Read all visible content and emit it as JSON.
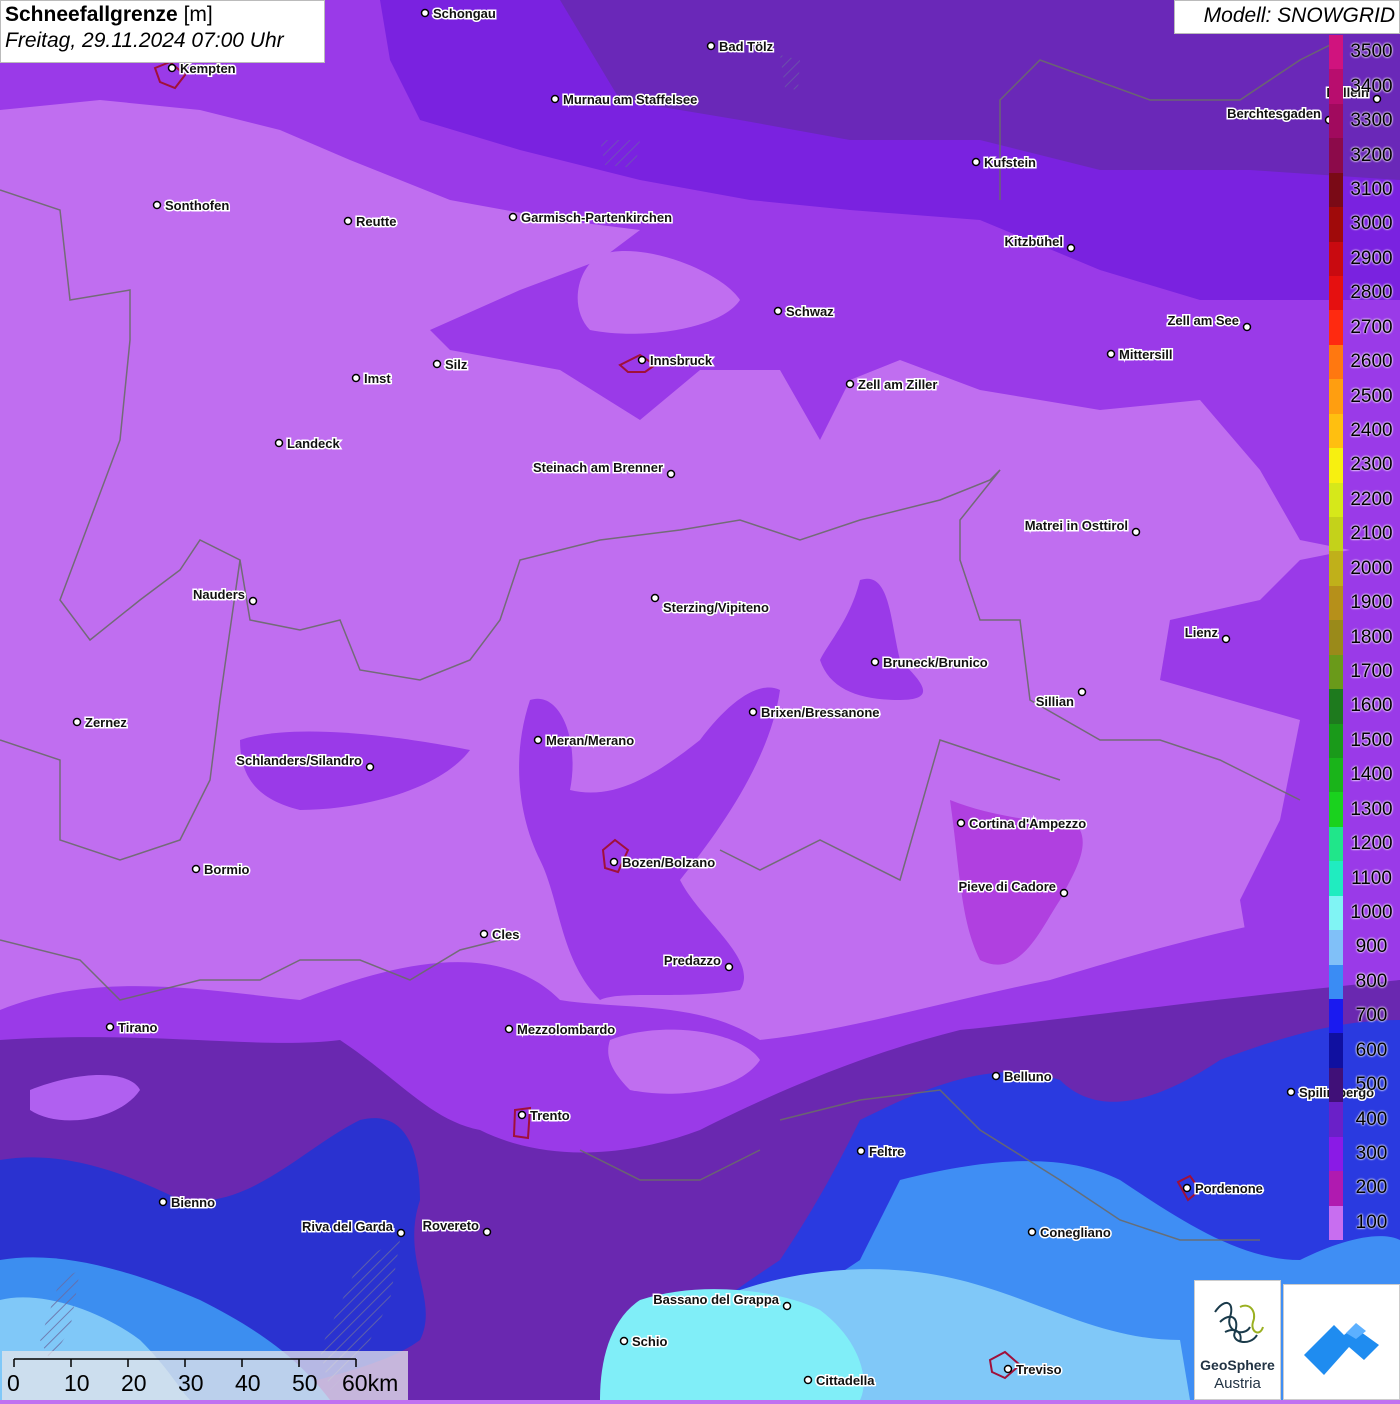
{
  "title": {
    "main": "Schneefallgrenze",
    "unit": "[m]",
    "date": "Freitag, 29.11.2024 07:00 Uhr"
  },
  "model": "Modell: SNOWGRID",
  "legend": {
    "levels": [
      {
        "label": "3500",
        "color": "#d0137e"
      },
      {
        "label": "3400",
        "color": "#b80d6e"
      },
      {
        "label": "3300",
        "color": "#a10a5e"
      },
      {
        "label": "3200",
        "color": "#8c0a4a"
      },
      {
        "label": "3100",
        "color": "#7a0a16"
      },
      {
        "label": "3000",
        "color": "#a00a0a"
      },
      {
        "label": "2900",
        "color": "#c90a10"
      },
      {
        "label": "2800",
        "color": "#e51010"
      },
      {
        "label": "2700",
        "color": "#ff2a10"
      },
      {
        "label": "2600",
        "color": "#ff7810"
      },
      {
        "label": "2500",
        "color": "#ff9e10"
      },
      {
        "label": "2400",
        "color": "#ffbf10"
      },
      {
        "label": "2300",
        "color": "#f7f010"
      },
      {
        "label": "2200",
        "color": "#d6e81a"
      },
      {
        "label": "2100",
        "color": "#c4d21a"
      },
      {
        "label": "2000",
        "color": "#c0b01a"
      },
      {
        "label": "1900",
        "color": "#b6901a"
      },
      {
        "label": "1800",
        "color": "#9a8a1a"
      },
      {
        "label": "1700",
        "color": "#6a9a1a"
      },
      {
        "label": "1600",
        "color": "#1e7a1e"
      },
      {
        "label": "1500",
        "color": "#1a9a1a"
      },
      {
        "label": "1400",
        "color": "#1ab41a"
      },
      {
        "label": "1300",
        "color": "#1ad21e"
      },
      {
        "label": "1200",
        "color": "#20e68a"
      },
      {
        "label": "1100",
        "color": "#20ecc0"
      },
      {
        "label": "1000",
        "color": "#80f4f4"
      },
      {
        "label": "900",
        "color": "#80c0f8"
      },
      {
        "label": "800",
        "color": "#3a8cf4"
      },
      {
        "label": "700",
        "color": "#1a1af0"
      },
      {
        "label": "600",
        "color": "#1010a0"
      },
      {
        "label": "500",
        "color": "#401078"
      },
      {
        "label": "400",
        "color": "#6a20c8"
      },
      {
        "label": "300",
        "color": "#8a1ae6"
      },
      {
        "label": "200",
        "color": "#b01ab0"
      },
      {
        "label": "100",
        "color": "#c86ef0"
      }
    ]
  },
  "cities": [
    {
      "name": "Schongau"
    },
    {
      "name": "Bad Tölz"
    },
    {
      "name": "Kempten"
    },
    {
      "name": "Murnau am Staffelsee"
    },
    {
      "name": "Berchtesgaden"
    },
    {
      "name": "Kufstein"
    },
    {
      "name": "Sonthofen"
    },
    {
      "name": "Reutte"
    },
    {
      "name": "Garmisch-Partenkirchen"
    },
    {
      "name": "Kitzbühel"
    },
    {
      "name": "Schwaz"
    },
    {
      "name": "Zell am See"
    },
    {
      "name": "Mittersill"
    },
    {
      "name": "Innsbruck"
    },
    {
      "name": "Silz"
    },
    {
      "name": "Imst"
    },
    {
      "name": "Zell am Ziller"
    },
    {
      "name": "Landeck"
    },
    {
      "name": "Steinach am Brenner"
    },
    {
      "name": "Matrei in Osttirol"
    },
    {
      "name": "Nauders"
    },
    {
      "name": "Sterzing/Vipiteno"
    },
    {
      "name": "Lienz"
    },
    {
      "name": "Bruneck/Brunico"
    },
    {
      "name": "Sillian"
    },
    {
      "name": "Brixen/Bressanone"
    },
    {
      "name": "Zernez"
    },
    {
      "name": "Meran/Merano"
    },
    {
      "name": "Schlanders/Silandro"
    },
    {
      "name": "Cortina d'Ampezzo"
    },
    {
      "name": "Bozen/Bolzano"
    },
    {
      "name": "Bormio"
    },
    {
      "name": "Pieve di Cadore"
    },
    {
      "name": "Cles"
    },
    {
      "name": "Predazzo"
    },
    {
      "name": "Tirano"
    },
    {
      "name": "Mezzolombardo"
    },
    {
      "name": "Belluno"
    },
    {
      "name": "Spilimbergo"
    },
    {
      "name": "Trento"
    },
    {
      "name": "Feltre"
    },
    {
      "name": "Pordenone"
    },
    {
      "name": "Bienno"
    },
    {
      "name": "Riva del Garda"
    },
    {
      "name": "Rovereto"
    },
    {
      "name": "Conegliano"
    },
    {
      "name": "Bassano del Grappa"
    },
    {
      "name": "Schio"
    },
    {
      "name": "Treviso"
    },
    {
      "name": "Cittadella"
    },
    {
      "name": "Hallein"
    }
  ],
  "scale": {
    "ticks": [
      "0",
      "10",
      "20",
      "30",
      "40",
      "50",
      "60km"
    ]
  },
  "logo": {
    "line1": "GeoSphere",
    "line2": "Austria"
  }
}
